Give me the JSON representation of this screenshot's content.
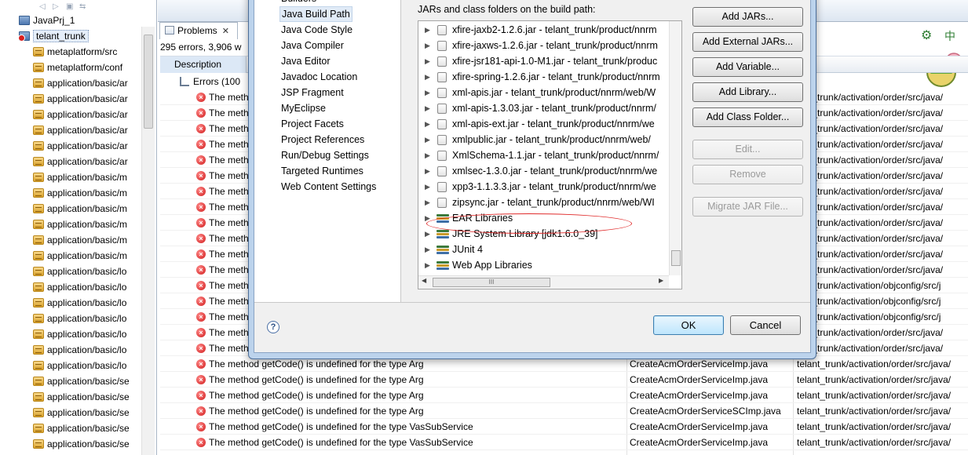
{
  "explorer": {
    "items": [
      {
        "label": "JavaPrj_1",
        "kind": "project"
      },
      {
        "label": "telant_trunk",
        "kind": "project-error"
      },
      {
        "label": "metaplatform/src",
        "kind": "package"
      },
      {
        "label": "metaplatform/conf",
        "kind": "package"
      },
      {
        "label": "application/basic/ar",
        "kind": "package"
      },
      {
        "label": "application/basic/ar",
        "kind": "package"
      },
      {
        "label": "application/basic/ar",
        "kind": "package"
      },
      {
        "label": "application/basic/ar",
        "kind": "package"
      },
      {
        "label": "application/basic/ar",
        "kind": "package"
      },
      {
        "label": "application/basic/ar",
        "kind": "package"
      },
      {
        "label": "application/basic/m",
        "kind": "package"
      },
      {
        "label": "application/basic/m",
        "kind": "package"
      },
      {
        "label": "application/basic/m",
        "kind": "package"
      },
      {
        "label": "application/basic/m",
        "kind": "package"
      },
      {
        "label": "application/basic/m",
        "kind": "package"
      },
      {
        "label": "application/basic/m",
        "kind": "package"
      },
      {
        "label": "application/basic/lo",
        "kind": "package"
      },
      {
        "label": "application/basic/lo",
        "kind": "package"
      },
      {
        "label": "application/basic/lo",
        "kind": "package"
      },
      {
        "label": "application/basic/lo",
        "kind": "package"
      },
      {
        "label": "application/basic/lo",
        "kind": "package"
      },
      {
        "label": "application/basic/lo",
        "kind": "package"
      },
      {
        "label": "application/basic/lo",
        "kind": "package"
      },
      {
        "label": "application/basic/se",
        "kind": "package"
      },
      {
        "label": "application/basic/se",
        "kind": "package"
      },
      {
        "label": "application/basic/se",
        "kind": "package"
      },
      {
        "label": "application/basic/se",
        "kind": "package"
      },
      {
        "label": "application/basic/se",
        "kind": "package"
      }
    ]
  },
  "problems": {
    "tab_label": "Problems",
    "summary": "295 errors, 3,906 w",
    "col_description": "Description",
    "errors_group": "Errors (100",
    "rows": [
      {
        "desc": "The meth",
        "res": "",
        "path": "lant_trunk/activation/order/src/java/"
      },
      {
        "desc": "The meth",
        "res": "",
        "path": "lant_trunk/activation/order/src/java/"
      },
      {
        "desc": "The meth",
        "res": "",
        "path": "lant_trunk/activation/order/src/java/"
      },
      {
        "desc": "The meth",
        "res": "",
        "path": "lant_trunk/activation/order/src/java/"
      },
      {
        "desc": "The meth",
        "res": "",
        "path": "lant_trunk/activation/order/src/java/"
      },
      {
        "desc": "The meth",
        "res": "",
        "path": "lant_trunk/activation/order/src/java/"
      },
      {
        "desc": "The meth",
        "res": "",
        "path": "lant_trunk/activation/order/src/java/"
      },
      {
        "desc": "The meth",
        "res": "",
        "path": "lant_trunk/activation/order/src/java/"
      },
      {
        "desc": "The meth",
        "res": "",
        "path": "lant_trunk/activation/order/src/java/"
      },
      {
        "desc": "The meth",
        "res": "",
        "path": "lant_trunk/activation/order/src/java/"
      },
      {
        "desc": "The meth",
        "res": "",
        "path": "lant_trunk/activation/order/src/java/"
      },
      {
        "desc": "The meth",
        "res": "",
        "path": "lant_trunk/activation/order/src/java/"
      },
      {
        "desc": "The meth",
        "res": "",
        "path": "lant_trunk/activation/objconfig/src/j"
      },
      {
        "desc": "The meth",
        "res": "",
        "path": "lant_trunk/activation/objconfig/src/j"
      },
      {
        "desc": "The meth",
        "res": "",
        "path": "lant_trunk/activation/objconfig/src/j"
      },
      {
        "desc": "The meth",
        "res": "",
        "path": "lant_trunk/activation/order/src/java/"
      },
      {
        "desc": "The meth",
        "res": "",
        "path": "lant_trunk/activation/order/src/java/"
      },
      {
        "desc": "The method getCode() is undefined for the type Arg",
        "res": "CreateAcmOrderServiceImp.java",
        "path": "telant_trunk/activation/order/src/java/"
      },
      {
        "desc": "The method getCode() is undefined for the type Arg",
        "res": "CreateAcmOrderServiceImp.java",
        "path": "telant_trunk/activation/order/src/java/"
      },
      {
        "desc": "The method getCode() is undefined for the type Arg",
        "res": "CreateAcmOrderServiceImp.java",
        "path": "telant_trunk/activation/order/src/java/"
      },
      {
        "desc": "The method getCode() is undefined for the type Arg",
        "res": "CreateAcmOrderServiceSCImp.java",
        "path": "telant_trunk/activation/order/src/java/"
      },
      {
        "desc": "The method getCode() is undefined for the type VasSubService",
        "res": "CreateAcmOrderServiceImp.java",
        "path": "telant_trunk/activation/order/src/java/"
      },
      {
        "desc": "The method getCode() is undefined for the type VasSubService",
        "res": "CreateAcmOrderServiceImp.java",
        "path": "telant_trunk/activation/order/src/java/"
      }
    ]
  },
  "dialog": {
    "categories": [
      {
        "label": "Builders",
        "selected": false
      },
      {
        "label": "Java Build Path",
        "selected": true
      },
      {
        "label": "Java Code Style",
        "selected": false
      },
      {
        "label": "Java Compiler",
        "selected": false
      },
      {
        "label": "Java Editor",
        "selected": false
      },
      {
        "label": "Javadoc Location",
        "selected": false
      },
      {
        "label": "JSP Fragment",
        "selected": false
      },
      {
        "label": "MyEclipse",
        "selected": false
      },
      {
        "label": "Project Facets",
        "selected": false
      },
      {
        "label": "Project References",
        "selected": false
      },
      {
        "label": "Run/Debug Settings",
        "selected": false
      },
      {
        "label": "Targeted Runtimes",
        "selected": false
      },
      {
        "label": "Web Content Settings",
        "selected": false
      }
    ],
    "jar_title": "JARs and class folders on the build path:",
    "jars": [
      {
        "label": "xfire-jaxb2-1.2.6.jar - telant_trunk/product/nnrm",
        "kind": "jar"
      },
      {
        "label": "xfire-jaxws-1.2.6.jar - telant_trunk/product/nnrm",
        "kind": "jar"
      },
      {
        "label": "xfire-jsr181-api-1.0-M1.jar - telant_trunk/produc",
        "kind": "jar"
      },
      {
        "label": "xfire-spring-1.2.6.jar - telant_trunk/product/nnrm",
        "kind": "jar"
      },
      {
        "label": "xml-apis.jar - telant_trunk/product/nnrm/web/W",
        "kind": "jar"
      },
      {
        "label": "xml-apis-1.3.03.jar - telant_trunk/product/nnrm/",
        "kind": "jar"
      },
      {
        "label": "xml-apis-ext.jar - telant_trunk/product/nnrm/we",
        "kind": "jar"
      },
      {
        "label": "xmlpublic.jar - telant_trunk/product/nnrm/web/",
        "kind": "jar"
      },
      {
        "label": "XmlSchema-1.1.jar - telant_trunk/product/nnrm/",
        "kind": "jar"
      },
      {
        "label": "xmlsec-1.3.0.jar - telant_trunk/product/nnrm/we",
        "kind": "jar"
      },
      {
        "label": "xpp3-1.1.3.3.jar - telant_trunk/product/nnrm/we",
        "kind": "jar"
      },
      {
        "label": "zipsync.jar - telant_trunk/product/nnrm/web/WI",
        "kind": "jar"
      },
      {
        "label": "EAR Libraries",
        "kind": "lib"
      },
      {
        "label": "JRE System Library [jdk1.6.0_39]",
        "kind": "lib"
      },
      {
        "label": "JUnit 4",
        "kind": "lib"
      },
      {
        "label": "Web App Libraries",
        "kind": "lib"
      }
    ],
    "hscroll_label": "III",
    "buttons": {
      "add_jars": "Add JARs...",
      "add_external_jars": "Add External JARs...",
      "add_variable": "Add Variable...",
      "add_library": "Add Library...",
      "add_class_folder": "Add Class Folder...",
      "edit": "Edit...",
      "remove": "Remove",
      "migrate_jar": "Migrate JAR File...",
      "ok": "OK",
      "cancel": "Cancel"
    },
    "help_glyph": "?"
  },
  "icons": {
    "gear": "⚙",
    "cjk_toolbar": "中",
    "tab_close": "✕",
    "tree_arrow": "▶"
  },
  "colors": {
    "annotation": "#e02b2b",
    "error": "#d01818"
  }
}
